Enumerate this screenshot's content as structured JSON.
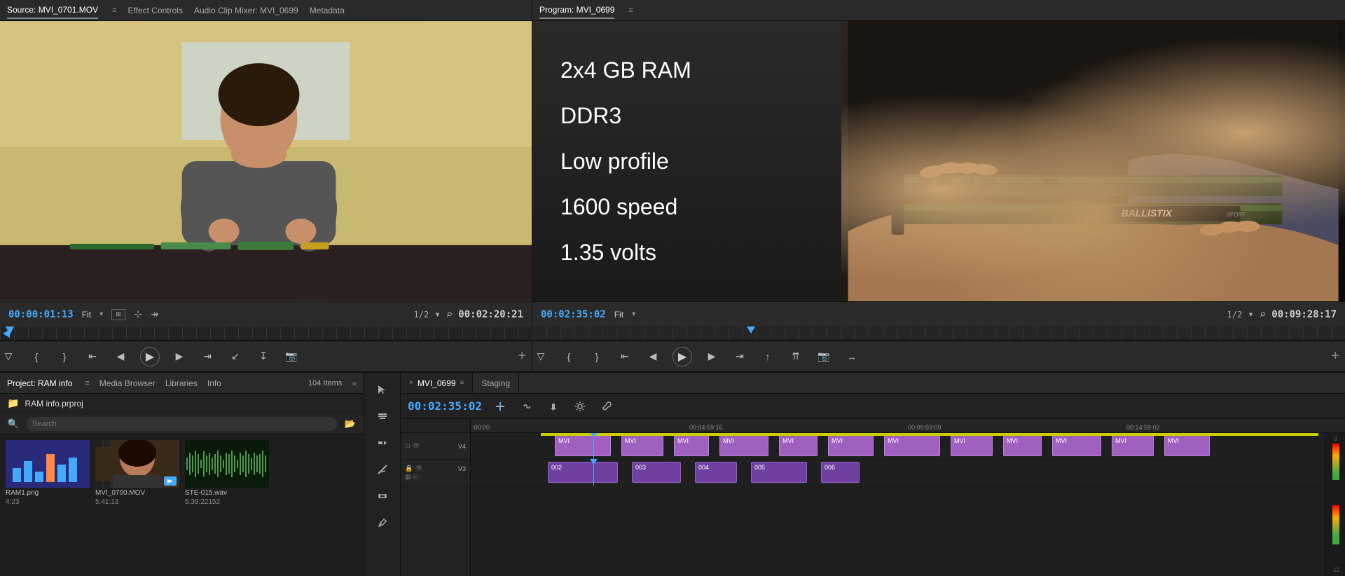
{
  "source": {
    "tabs": [
      {
        "id": "source-tab",
        "label": "Source: MVI_0701.MOV",
        "active": true
      },
      {
        "id": "effect-controls-tab",
        "label": "Effect Controls",
        "active": false
      },
      {
        "id": "audio-clip-mixer-tab",
        "label": "Audio Clip Mixer: MVI_0699",
        "active": false
      },
      {
        "id": "metadata-tab",
        "label": "Metadata",
        "active": false
      }
    ],
    "timecode": "00:00:01:13",
    "fit_label": "Fit",
    "fraction": "1/2",
    "total_time": "00:02:20:21"
  },
  "program": {
    "title": "Program: MVI_0699",
    "timecode": "00:02:35:02",
    "fit_label": "Fit",
    "fraction": "1/2",
    "total_time": "00:09:28:17",
    "text_overlay": {
      "line1": "2x4 GB RAM",
      "line2": "DDR3",
      "line3": "Low profile",
      "line4": "1600 speed",
      "line5": "1.35 volts"
    },
    "ram_brand": "BALLISTIX"
  },
  "project": {
    "title": "Project: RAM info",
    "tabs": [
      {
        "label": "Project: RAM info",
        "active": true
      },
      {
        "label": "Media Browser",
        "active": false
      },
      {
        "label": "Libraries",
        "active": false
      },
      {
        "label": "Info",
        "active": false
      }
    ],
    "items_count": "104 Items",
    "folder": {
      "name": "RAM info.prproj"
    },
    "assets": [
      {
        "name": "RAM1.png",
        "duration": "4:23",
        "type": "image"
      },
      {
        "name": "MVI_0700.MOV",
        "duration": "5:41:13",
        "type": "video"
      },
      {
        "name": "STE-015.wav",
        "duration": "5:39:22152",
        "type": "audio"
      }
    ]
  },
  "timeline": {
    "tab1": "MVI_0699",
    "tab2": "Staging",
    "timecode": "00:02:35:02",
    "ruler_times": [
      ":00:00",
      "00:04:59:16",
      "00:09:59:09",
      "00:14:59:02"
    ],
    "tracks": [
      {
        "name": "V4",
        "type": "video"
      },
      {
        "name": "V3",
        "type": "video"
      }
    ],
    "tools": [
      "▲",
      "↔",
      "←→",
      "↔",
      "+",
      "⊕"
    ]
  },
  "icons": {
    "play": "▶",
    "pause": "⏸",
    "step_back": "⏮",
    "step_forward": "⏭",
    "rewind": "◀◀",
    "ff": "▶▶",
    "folder": "📁",
    "search": "🔍",
    "new_folder": "📂",
    "settings": "⚙",
    "menu": "≡",
    "close": "×",
    "chevron_down": "▾",
    "chevron_right": "▸",
    "loop": "↺",
    "mark_in": "{",
    "mark_out": "}",
    "to_in": "⇤",
    "to_out": "⇥",
    "camera": "📷",
    "export": "↗",
    "plus": "+",
    "eye": "👁",
    "lock": "🔒"
  }
}
